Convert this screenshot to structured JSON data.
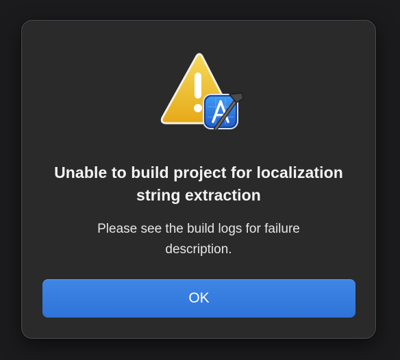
{
  "alert": {
    "icon": "warning-triangle-with-xcode-badge",
    "title": "Unable to build project for localization string extraction",
    "message": "Please see the build logs for failure description.",
    "ok_label": "OK"
  },
  "colors": {
    "dialog_background": "#2a2a2b",
    "button_accent": "#3478e0",
    "warning_yellow": "#f2c230",
    "badge_blue": "#2f7ce8"
  }
}
